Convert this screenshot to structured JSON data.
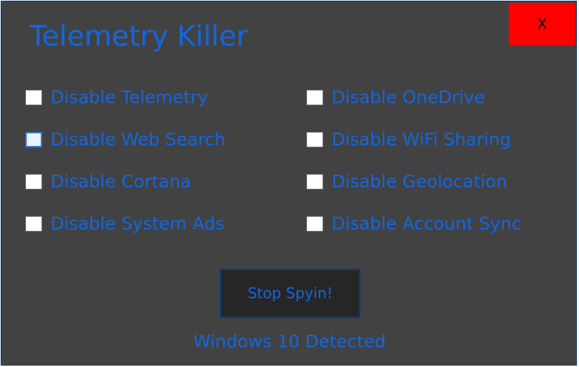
{
  "window": {
    "title": "Telemetry Killer",
    "close_label": "X"
  },
  "options": {
    "left_column": [
      {
        "label": "Disable Telemetry",
        "checked": false
      },
      {
        "label": "Disable Web Search",
        "checked": false
      },
      {
        "label": "Disable Cortana",
        "checked": false
      },
      {
        "label": "Disable System Ads",
        "checked": false
      }
    ],
    "right_column": [
      {
        "label": "Disable OneDrive",
        "checked": false
      },
      {
        "label": "Disable WiFi Sharing",
        "checked": false
      },
      {
        "label": "Disable Geolocation",
        "checked": false
      },
      {
        "label": "Disable Account Sync",
        "checked": false
      }
    ]
  },
  "actions": {
    "stop_label": "Stop Spyin!"
  },
  "status": {
    "text": "Windows 10 Detected"
  },
  "colors": {
    "background": "#424242",
    "accent_text": "#1466e0",
    "close_button": "#ff0000",
    "button_background": "#262626"
  }
}
